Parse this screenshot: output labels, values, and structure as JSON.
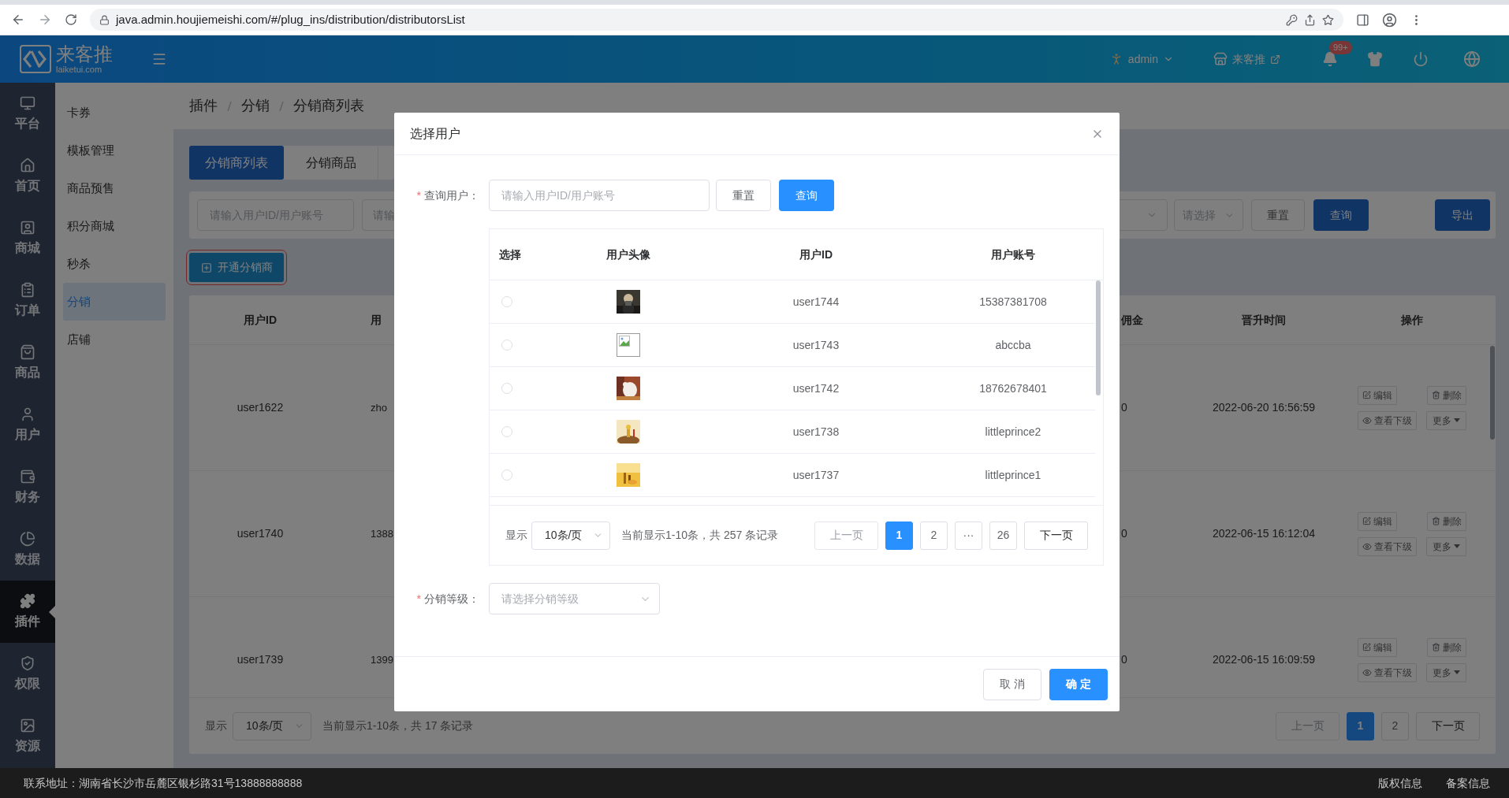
{
  "browser": {
    "url": "java.admin.houjiemeishi.com/#/plug_ins/distribution/distributorsList"
  },
  "header": {
    "logo_name": "来客推",
    "logo_domain": "laiketui.com",
    "user": "admin",
    "store": "来客推",
    "badge": "99+"
  },
  "nav": [
    {
      "label": "平台",
      "selected": false
    },
    {
      "label": "首页",
      "selected": false
    },
    {
      "label": "商城",
      "selected": false
    },
    {
      "label": "订单",
      "selected": false
    },
    {
      "label": "商品",
      "selected": false
    },
    {
      "label": "用户",
      "selected": false
    },
    {
      "label": "财务",
      "selected": false
    },
    {
      "label": "数据",
      "selected": false
    },
    {
      "label": "插件",
      "selected": true
    },
    {
      "label": "权限",
      "selected": false
    },
    {
      "label": "资源",
      "selected": false
    }
  ],
  "subnav": [
    {
      "label": "卡券",
      "selected": false
    },
    {
      "label": "模板管理",
      "selected": false
    },
    {
      "label": "商品预售",
      "selected": false
    },
    {
      "label": "积分商城",
      "selected": false
    },
    {
      "label": "秒杀",
      "selected": false
    },
    {
      "label": "分销",
      "selected": true
    },
    {
      "label": "店铺",
      "selected": false
    }
  ],
  "breadcrumb": [
    "插件",
    "分销",
    "分销商列表"
  ],
  "tabs": [
    {
      "label": "分销商列表",
      "selected": true
    },
    {
      "label": "分销商品",
      "selected": false
    }
  ],
  "filters": {
    "user_placeholder": "请输入用户ID/用户账号",
    "second_placeholder": "请输",
    "select_placeholder": "请选择",
    "reset": "重置",
    "search": "查询",
    "export": "导出"
  },
  "open_button": "开通分销商",
  "table": {
    "columns": [
      "用户ID",
      "用",
      "佣金",
      "晋升时间",
      "操作"
    ],
    "rows": [
      {
        "cells": [
          "user1622",
          "zho",
          "0",
          "2022-06-20 16:56:59"
        ],
        "actions": [
          "编辑",
          "删除",
          "查看下级",
          "更多"
        ]
      },
      {
        "cells": [
          "user1740",
          "1388",
          "0",
          "2022-06-15 16:12:04"
        ],
        "actions": [
          "编辑",
          "删除",
          "查看下级",
          "更多"
        ]
      },
      {
        "cells": [
          "user1739",
          "1399",
          "0",
          "2022-06-15 16:09:59"
        ],
        "actions": [
          "编辑",
          "删除",
          "查看下级",
          "更多"
        ]
      }
    ]
  },
  "pagination": {
    "show_label": "显示",
    "page_size": "10条/页",
    "summary": "当前显示1-10条，共 17 条记录",
    "prev": {
      "label": "上一页",
      "disabled": true
    },
    "next": {
      "label": "下一页",
      "disabled": false
    },
    "pages": [
      {
        "label": "1",
        "selected": true
      },
      {
        "label": "2",
        "selected": false
      }
    ]
  },
  "modal": {
    "title": "选择用户",
    "query": {
      "mark": "*",
      "label": "查询用户：",
      "placeholder": "请输入用户ID/用户账号",
      "reset": "重置",
      "search": "查询"
    },
    "columns": [
      "选择",
      "用户头像",
      "用户ID",
      "用户账号"
    ],
    "rows": [
      {
        "selected": false,
        "kind": "picture",
        "user_id": "user1744",
        "account": "15387381708"
      },
      {
        "selected": false,
        "kind": "broken",
        "user_id": "user1743",
        "account": "abccba"
      },
      {
        "selected": false,
        "kind": "picture",
        "user_id": "user1742",
        "account": "18762678401"
      },
      {
        "selected": false,
        "kind": "picture",
        "user_id": "user1738",
        "account": "littleprince2"
      },
      {
        "selected": false,
        "kind": "picture",
        "user_id": "user1737",
        "account": "littleprince1"
      }
    ],
    "pagination": {
      "show_label": "显示",
      "page_size": "10条/页",
      "summary": "当前显示1-10条，共 257 条记录",
      "prev": {
        "label": "上一页",
        "disabled": true
      },
      "next": {
        "label": "下一页",
        "disabled": false
      },
      "pages": [
        {
          "label": "1",
          "selected": true
        },
        {
          "label": "2",
          "selected": false
        },
        {
          "label": "···",
          "selected": false
        },
        {
          "label": "26",
          "selected": false
        }
      ]
    },
    "level": {
      "mark": "*",
      "label": "分销等级：",
      "placeholder": "请选择分销等级"
    },
    "cancel": "取 消",
    "confirm": "确 定"
  },
  "footer": {
    "address": "联系地址：湖南省长沙市岳麓区银杉路31号13888888888",
    "links": [
      "版权信息",
      "备案信息"
    ]
  }
}
